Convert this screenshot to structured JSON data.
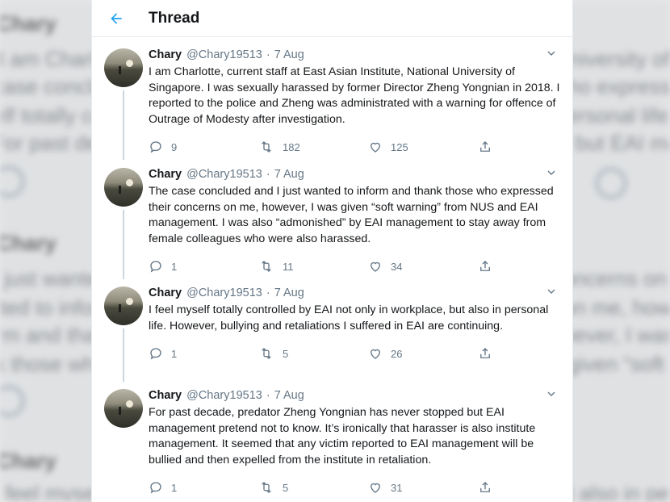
{
  "header": {
    "title": "Thread"
  },
  "tweets": [
    {
      "name": "Chary",
      "handle": "@Chary19513",
      "dot": "·",
      "date": "7 Aug",
      "text": "I am Charlotte, current staff at East Asian Institute, National University of Singapore. I was sexually harassed by former Director Zheng Yongnian in 2018. I reported to the police and Zheng was administrated with a warning for offence of Outrage of Modesty after investigation.",
      "replies": "9",
      "retweets": "182",
      "likes": "125"
    },
    {
      "name": "Chary",
      "handle": "@Chary19513",
      "dot": "·",
      "date": "7 Aug",
      "text": "The case concluded and I just wanted to inform and thank those who expressed their concerns on me, however, I was given “soft warning” from NUS and EAI management. I was also “admonished” by EAI management to stay away from female colleagues who were also harassed.",
      "replies": "1",
      "retweets": "11",
      "likes": "34"
    },
    {
      "name": "Chary",
      "handle": "@Chary19513",
      "dot": "·",
      "date": "7 Aug",
      "text": "I feel myself totally controlled by EAI not only in workplace, but also in personal life. However, bullying and retaliations I suffered in EAI are continuing.",
      "replies": "1",
      "retweets": "5",
      "likes": "26"
    },
    {
      "name": "Chary",
      "handle": "@Chary19513",
      "dot": "·",
      "date": "7 Aug",
      "text": "For past decade, predator Zheng Yongnian has never stopped but EAI management pretend not to know. It’s ironically that harasser is also institute management. It seemed that any victim reported to EAI management will be bullied and then expelled from the institute in retaliation.",
      "replies": "1",
      "retweets": "5",
      "likes": "31"
    }
  ],
  "icons": {
    "back": "arrow-left-icon",
    "more": "chevron-down-icon",
    "reply": "reply-icon",
    "retweet": "retweet-icon",
    "like": "heart-icon",
    "share": "share-icon"
  },
  "colors": {
    "accent": "#1da1f2",
    "text": "#14171a",
    "muted": "#657786",
    "thread_line": "#ccd6dd"
  }
}
